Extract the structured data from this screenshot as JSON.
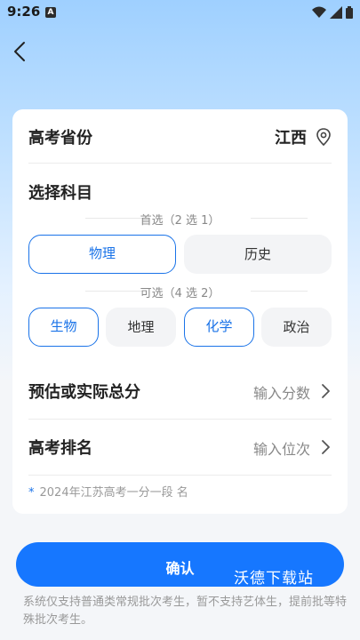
{
  "status_bar": {
    "time": "9:26",
    "notification": "A"
  },
  "province": {
    "label": "高考省份",
    "value": "江西"
  },
  "subjects": {
    "title": "选择科目",
    "primary_label": "首选（2 选 1）",
    "primary_options": [
      {
        "label": "物理",
        "selected": true
      },
      {
        "label": "历史",
        "selected": false
      }
    ],
    "secondary_label": "可选（4 选 2）",
    "secondary_options": [
      {
        "label": "生物",
        "selected": true
      },
      {
        "label": "地理",
        "selected": false
      },
      {
        "label": "化学",
        "selected": true
      },
      {
        "label": "政治",
        "selected": false
      }
    ]
  },
  "score": {
    "label": "预估或实际总分",
    "placeholder": "输入分数"
  },
  "rank": {
    "label": "高考排名",
    "placeholder": "输入位次"
  },
  "footnote": {
    "star": "*",
    "text": "2024年江苏高考一分一段 名"
  },
  "confirm": {
    "label": "确认",
    "watermark": "沃德下载站"
  },
  "disclaimer": "系统仅支持普通类常规批次考生，暂不支持艺体生，提前批等特殊批次考生。",
  "colors": {
    "accent": "#1677ff",
    "selected_border": "#1a73e8"
  }
}
